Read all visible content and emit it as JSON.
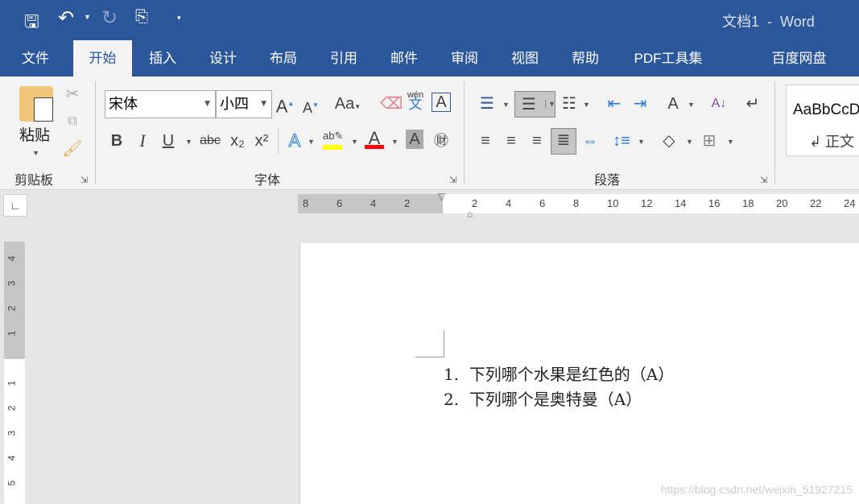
{
  "titlebar": {
    "doc_name": "文档1",
    "separator": "-",
    "app": "Word",
    "icons": [
      "save-icon",
      "undo-icon",
      "redo-icon",
      "touch-mode-icon",
      "customize-qat-icon"
    ]
  },
  "tabs": [
    {
      "label": "文件"
    },
    {
      "label": "开始",
      "active": true
    },
    {
      "label": "插入"
    },
    {
      "label": "设计"
    },
    {
      "label": "布局"
    },
    {
      "label": "引用"
    },
    {
      "label": "邮件"
    },
    {
      "label": "审阅"
    },
    {
      "label": "视图"
    },
    {
      "label": "帮助"
    },
    {
      "label": "PDF工具集"
    },
    {
      "label": "百度网盘"
    }
  ],
  "ribbon": {
    "clipboard": {
      "paste": "粘贴",
      "group": "剪贴板"
    },
    "font": {
      "font_name": "宋体",
      "font_size": "小四",
      "group": "字体",
      "bold": "B",
      "italic": "I",
      "underline": "U",
      "strike": "abc",
      "sub": "x₂",
      "sup": "x²",
      "change_case": "Aa",
      "phonetic_top": "wén",
      "phonetic": "文",
      "highlight_color": "#ffff00",
      "font_color": "#ff0000"
    },
    "paragraph": {
      "group": "段落"
    },
    "styles": {
      "preview": "AaBbCcD",
      "name": "正文"
    }
  },
  "ruler": {
    "h_labels": [
      "8",
      "6",
      "4",
      "2",
      "",
      "2",
      "4",
      "6",
      "8",
      "10",
      "12",
      "14",
      "16",
      "18",
      "20",
      "22",
      "24"
    ],
    "v_labels": [
      "4",
      "3",
      "2",
      "1",
      "",
      "1",
      "2",
      "3",
      "4",
      "5"
    ]
  },
  "document": {
    "items": [
      {
        "num": "1.",
        "text": "下列哪个水果是红色的（A）"
      },
      {
        "num": "2.",
        "text": "下列哪个是奥特曼（A）"
      }
    ]
  },
  "watermark": "https://blog.csdn.net/weixin_51927215"
}
